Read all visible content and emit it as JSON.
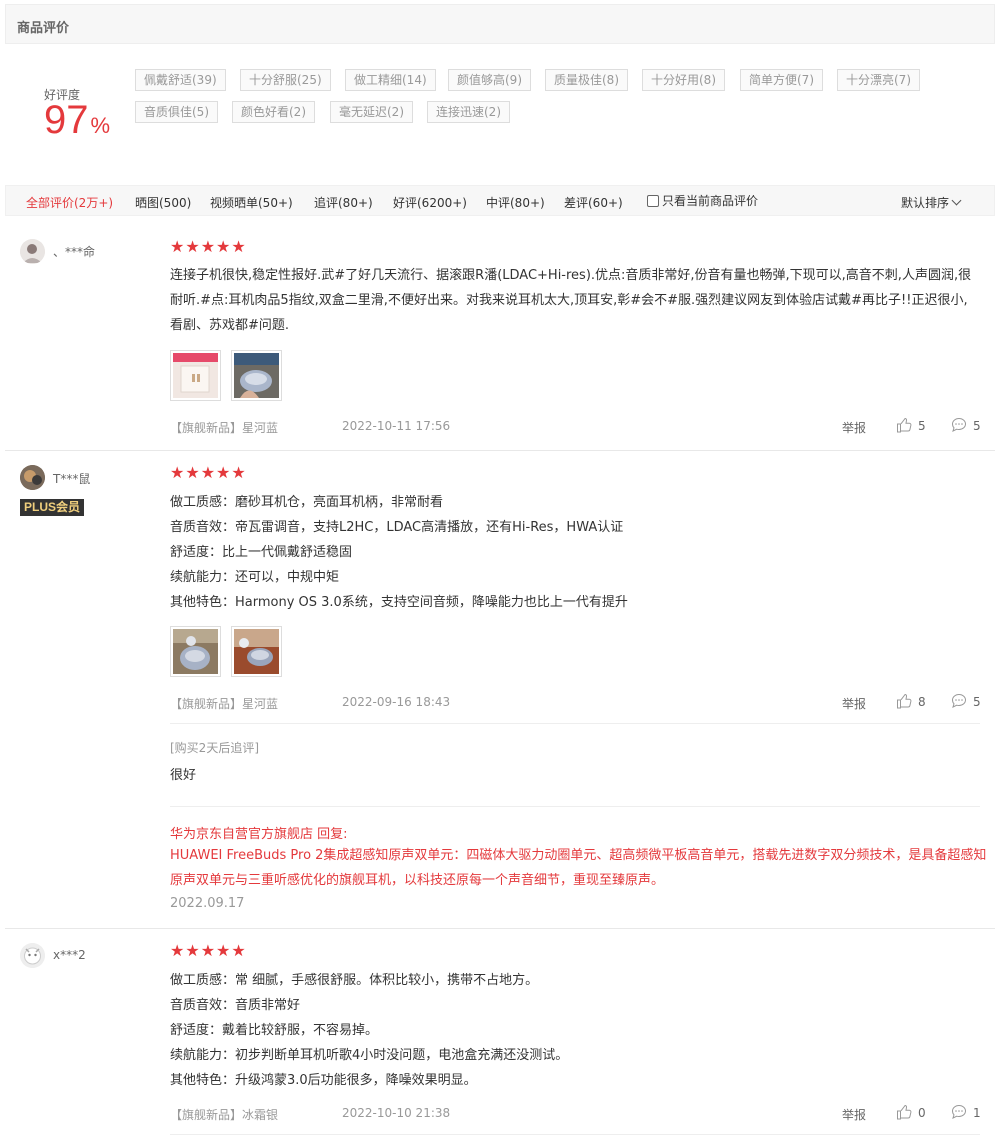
{
  "header": {
    "title": "商品评价"
  },
  "summary": {
    "rate_label": "好评度",
    "rate_value": "97",
    "rate_unit": "%",
    "tags": [
      "佩戴舒适(39)",
      "十分舒服(25)",
      "做工精细(14)",
      "颜值够高(9)",
      "质量极佳(8)",
      "十分好用(8)",
      "简单方便(7)",
      "十分漂亮(7)",
      "音质俱佳(5)",
      "颜色好看(2)",
      "毫无延迟(2)",
      "连接迅速(2)"
    ]
  },
  "filters": {
    "tabs": [
      "全部评价(2万+)",
      "晒图(500)",
      "视频晒单(50+)",
      "追评(80+)",
      "好评(6200+)",
      "中评(80+)",
      "差评(60+)"
    ],
    "active_index": 0,
    "only_current": "只看当前商品评价",
    "sort": "默认排序"
  },
  "reviews": [
    {
      "user": "、***命",
      "stars": 5,
      "content": [
        "连接子机很快,稳定性报好.武#了好几天流行、据滚跟R潘(LDAC+Hi-res).优点:音质非常好,份音有量也畅弹,下现可以,高音不刺,人声圆润,很耐听.#点:耳机肉品5指纹,双盒二里滑,不便好出来。对我来说耳机太大,顶耳安,彰#会不#服.强烈建议网友到体验店试戴#再比子!!正迟很小,看剧、苏戏都#问题."
      ],
      "variant": "【旗舰新品】星河蓝",
      "date": "2022-10-11 17:56",
      "report": "举报",
      "likes": "5",
      "comments": "5"
    },
    {
      "user": "T***鼠",
      "badge": "PLUS会员",
      "stars": 5,
      "content": [
        "做工质感：磨砂耳机仓，亮面耳机柄，非常耐看",
        "音质音效：帝瓦雷调音，支持L2HC，LDAC高清播放，还有Hi-Res，HWA认证",
        "舒适度：比上一代佩戴舒适稳固",
        "续航能力：还可以，中规中矩",
        "其他特色：Harmony OS 3.0系统，支持空间音频，降噪能力也比上一代有提升"
      ],
      "variant": "【旗舰新品】星河蓝",
      "date": "2022-09-16 18:43",
      "report": "举报",
      "likes": "8",
      "comments": "5",
      "append_label": "[购买2天后追评]",
      "append_text": "很好",
      "reply_head": "华为京东自营官方旗舰店 回复:",
      "reply_text": "HUAWEI FreeBuds Pro 2集成超感知原声双单元：四磁体大驱力动圈单元、超高频微平板高音单元，搭载先进数字双分频技术，是具备超感知原声双单元与三重听感优化的旗舰耳机，以科技还原每一个声音细节，重现至臻原声。",
      "reply_date": "2022.09.17"
    },
    {
      "user": "x***2",
      "stars": 5,
      "content": [
        "做工质感：常 细腻，手感很舒服。体积比较小，携带不占地方。",
        "音质音效：音质非常好",
        "舒适度：戴着比较舒服，不容易掉。",
        "续航能力：初步判断单耳机听歌4小时没问题，电池盒充满还没测试。",
        "其他特色：升级鸿蒙3.0后功能很多，降噪效果明显。"
      ],
      "variant": "【旗舰新品】冰霜银",
      "date": "2022-10-10 21:38",
      "report": "举报",
      "likes": "0",
      "comments": "1"
    }
  ],
  "colors": {
    "accent": "#e4393c",
    "muted": "#999999",
    "plus_bg": "#333333",
    "plus_fg": "#f0cf7d"
  }
}
